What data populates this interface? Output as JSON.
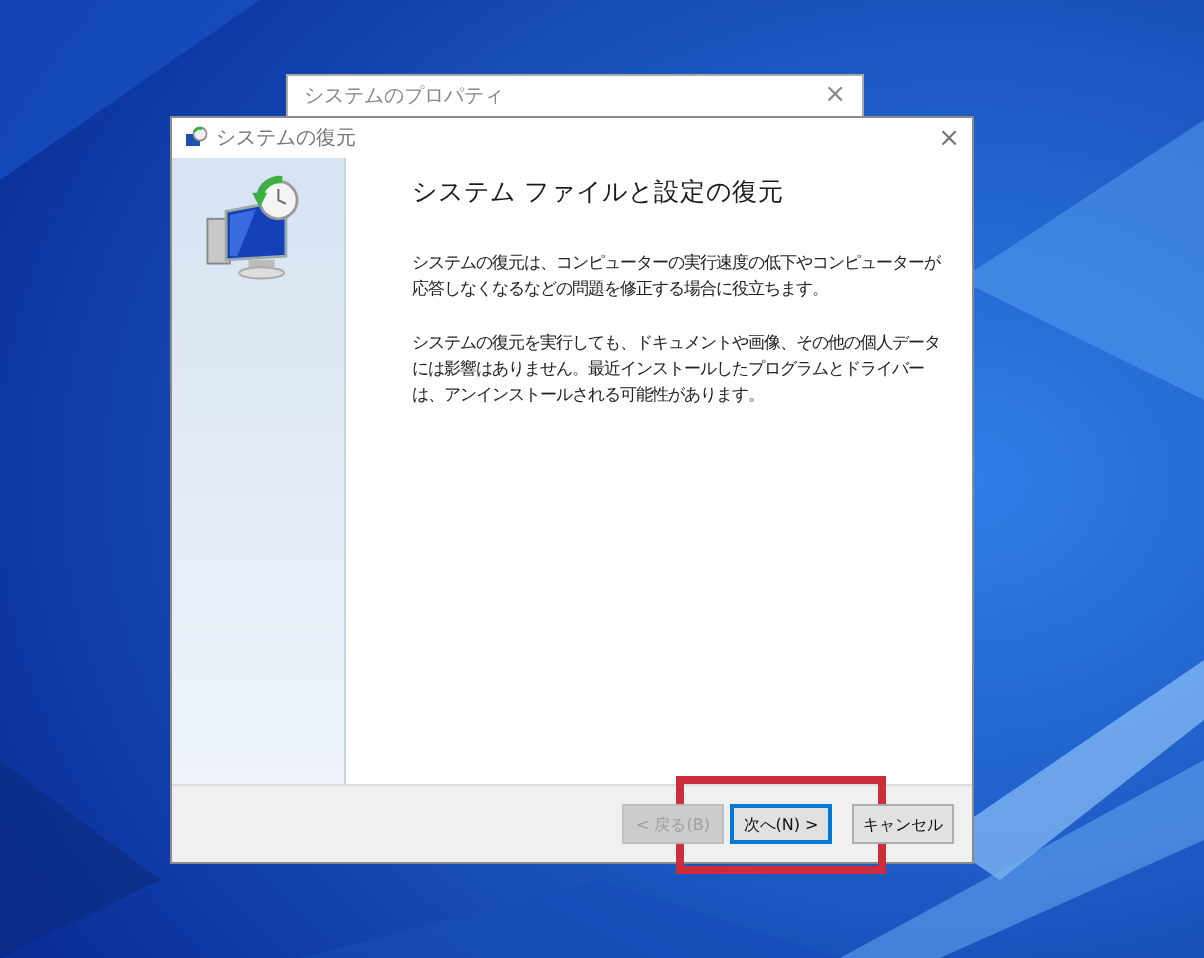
{
  "background_window": {
    "title": "システムのプロパティ",
    "close": "×"
  },
  "window": {
    "title": "システムの復元",
    "close": "×"
  },
  "heading": "システム ファイルと設定の復元",
  "paragraphs": [
    "システムの復元は、コンピューターの実行速度の低下やコンピューターが応答しなくなるなどの問題を修正する場合に役立ちます。",
    "システムの復元を実行しても、ドキュメントや画像、その他の個人データには影響はありません。最近インストールしたプログラムとドライバーは、アンインストールされる可能性があります。"
  ],
  "buttons": [
    {
      "label": "< 戻る(B)",
      "disabled": true,
      "default": false
    },
    {
      "label": "次へ(N) >",
      "disabled": false,
      "default": true
    },
    {
      "label": "キャンセル",
      "disabled": false,
      "default": false
    }
  ],
  "highlight": {
    "shown": true
  }
}
